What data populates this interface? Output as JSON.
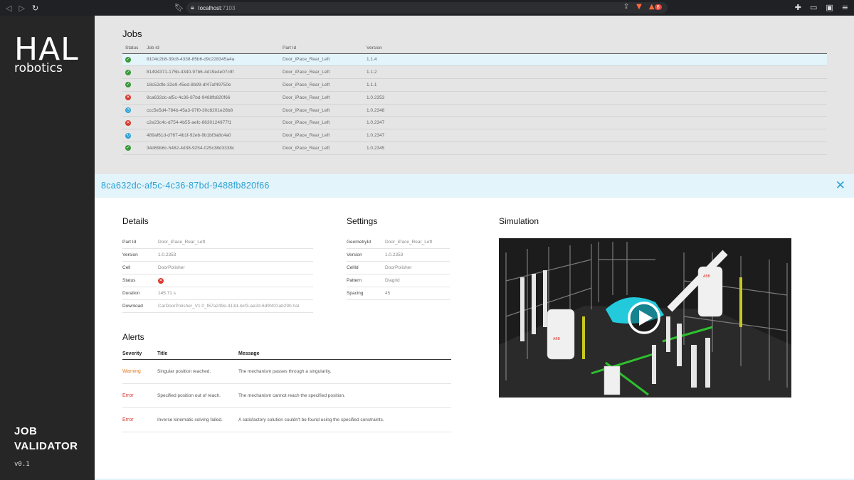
{
  "browser": {
    "url_host": "localhost",
    "url_port": ":7103",
    "notification_count": "6"
  },
  "sidebar": {
    "logo_hal": "HAL",
    "logo_robotics": "robotics",
    "app_name_line1": "JOB",
    "app_name_line2": "VALIDATOR",
    "version": "v0.1"
  },
  "jobs": {
    "title": "Jobs",
    "columns": [
      "Status",
      "Job Id",
      "Part Id",
      "Version"
    ],
    "rows": [
      {
        "status": "success",
        "job_id": "8104c2b8-39c8-4338-85b6-d9c228345a4a",
        "part_id": "Door_iPace_Rear_Left",
        "version": "1.1.4"
      },
      {
        "status": "success",
        "job_id": "81494371-175b-4340-97b6-4d19e4e07c9f",
        "part_id": "Door_iPace_Rear_Left",
        "version": "1.1.2"
      },
      {
        "status": "success",
        "job_id": "18c52dfe-32e9-45ed-8b99-df47af49750e",
        "part_id": "Door_iPace_Rear_Left",
        "version": "1.1.1"
      },
      {
        "status": "error",
        "job_id": "8ca632dc-af5c-4c36-87bd-9488fb820f66",
        "part_id": "Door_iPace_Rear_Left",
        "version": "1.0.2353"
      },
      {
        "status": "pending",
        "job_id": "ccc5e5d4-784b-45a3-97f0-30c8201e28b8",
        "part_id": "Door_iPace_Rear_Left",
        "version": "1.0.2348"
      },
      {
        "status": "error",
        "job_id": "c2e23c4c-d754-4b55-aefc-8630124977f1",
        "part_id": "Door_iPace_Rear_Left",
        "version": "1.0.2347"
      },
      {
        "status": "running",
        "job_id": "489af61d-d767-4b1f-92eb-9b1bf3a8c4a0",
        "part_id": "Door_iPace_Rear_Left",
        "version": "1.0.2347"
      },
      {
        "status": "success",
        "job_id": "34d69b6c-5462-4d38-9254-025c38d3338c",
        "part_id": "Door_iPace_Rear_Left",
        "version": "1.0.2345"
      }
    ]
  },
  "detail": {
    "job_id": "8ca632dc-af5c-4c36-87bd-9488fb820f66",
    "details": {
      "title": "Details",
      "rows": [
        {
          "key": "Part Id",
          "value": "Door_iPace_Rear_Left"
        },
        {
          "key": "Version",
          "value": "1.0.2353"
        },
        {
          "key": "Cell",
          "value": "DoorPolisher"
        },
        {
          "key": "Status",
          "value": ""
        },
        {
          "key": "Duration",
          "value": "145.71 s"
        },
        {
          "key": "Download",
          "value": "CarDoorPolisher_V1.0_f67a249e-413d-4ef3-ae2d-6d9f402ab290.hal"
        }
      ]
    },
    "settings": {
      "title": "Settings",
      "rows": [
        {
          "key": "GeometryId",
          "value": "Door_iPace_Rear_Left"
        },
        {
          "key": "Version",
          "value": "1.0.2353"
        },
        {
          "key": "CellId",
          "value": "DoorPolisher"
        },
        {
          "key": "Pattern",
          "value": "Diagrid"
        },
        {
          "key": "Spacing",
          "value": "45"
        }
      ]
    },
    "simulation": {
      "title": "Simulation",
      "robot_brand": "ABB"
    },
    "alerts": {
      "title": "Alerts",
      "columns": [
        "Severity",
        "Title",
        "Message"
      ],
      "rows": [
        {
          "severity": "Warning",
          "title": "Singular position reached.",
          "message": "The mechanism passes through a singularity."
        },
        {
          "severity": "Error",
          "title": "Specified position out of reach.",
          "message": "The mechanism cannot reach the specified position."
        },
        {
          "severity": "Error",
          "title": "Inverse kinematic solving failed.",
          "message": "A satisfactory solution couldn't be found using the specified constraints."
        }
      ]
    }
  },
  "colors": {
    "accent": "#2aa1d3",
    "success": "#3a9a3a",
    "error": "#d73a2e",
    "warning": "#e07a1c",
    "sidebar": "#262626"
  }
}
